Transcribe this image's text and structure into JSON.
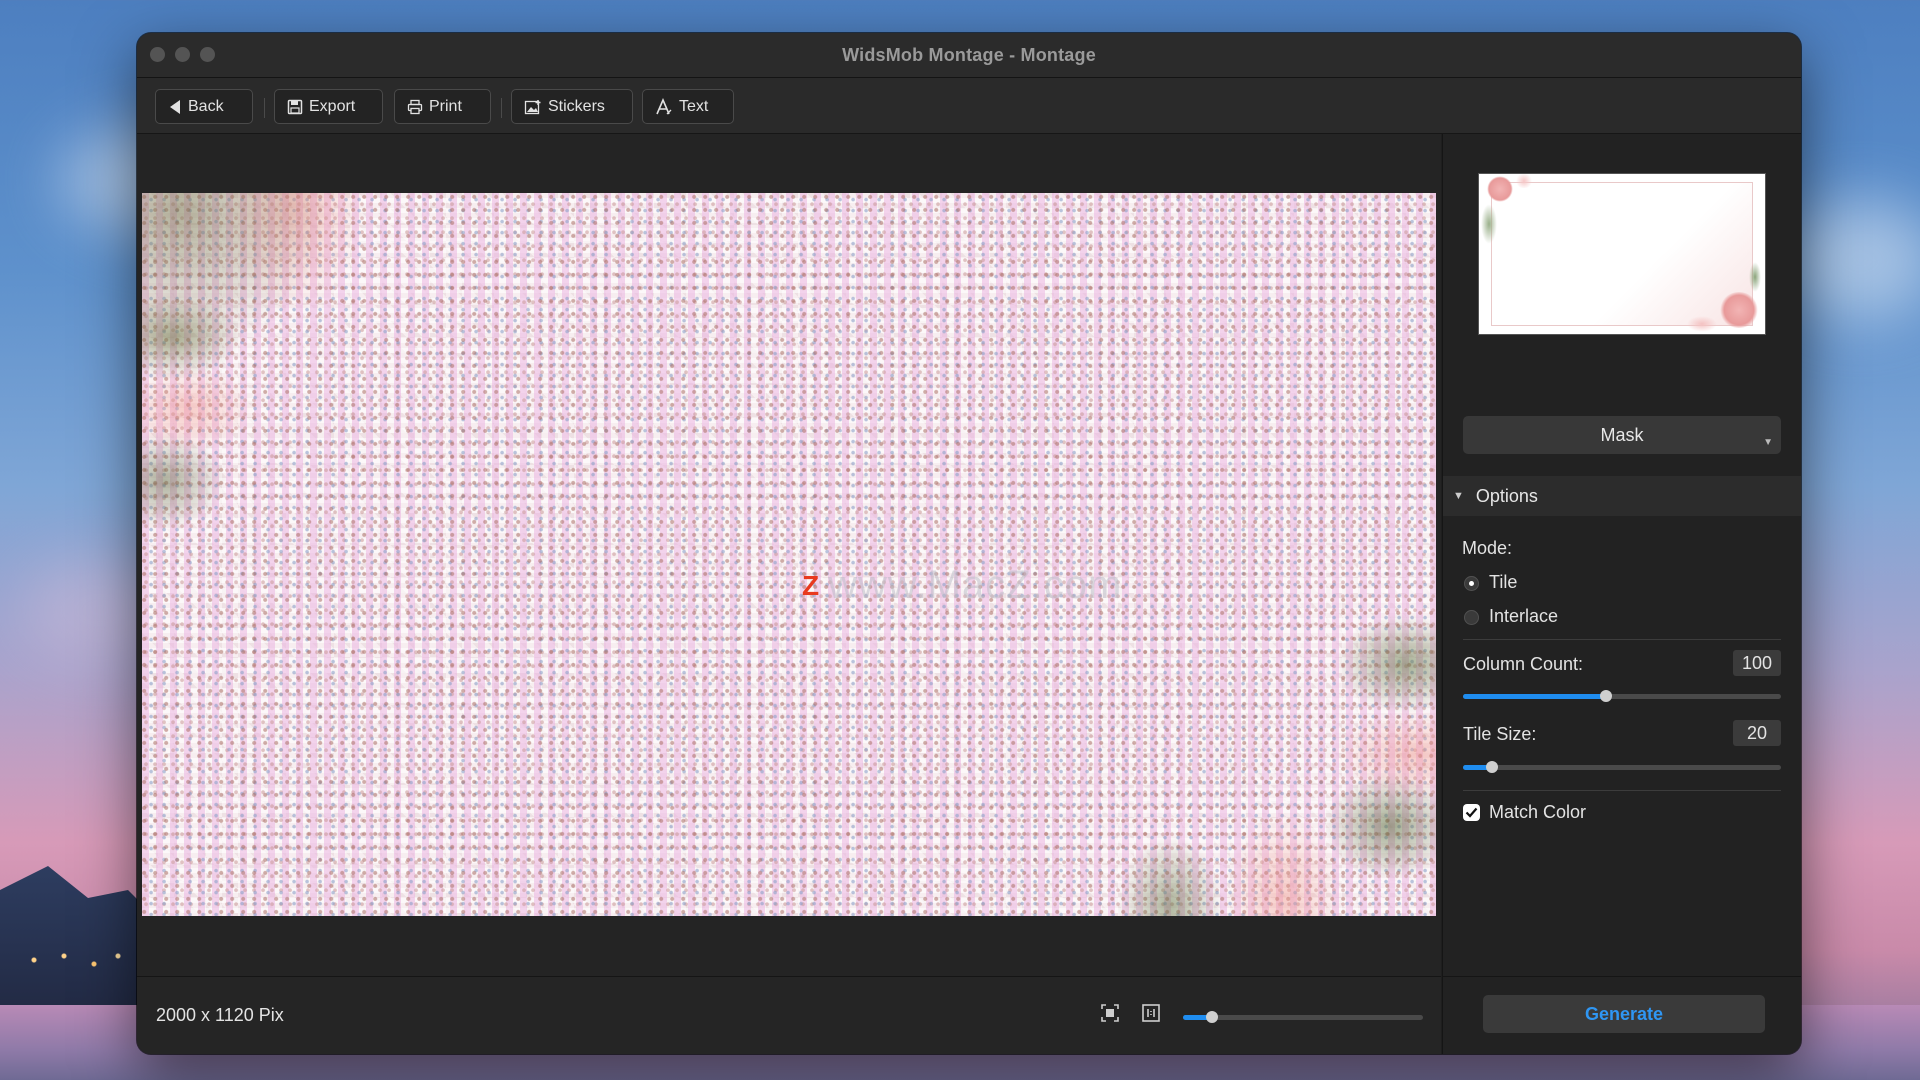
{
  "window": {
    "title": "WidsMob Montage - Montage"
  },
  "toolbar": {
    "back_label": "Back",
    "export_label": "Export",
    "print_label": "Print",
    "stickers_label": "Stickers",
    "text_label": "Text"
  },
  "canvas": {
    "watermark_text": "www.MacZ.com",
    "watermark_logo": "Z"
  },
  "side": {
    "mask_label": "Mask",
    "options_label": "Options",
    "mode_label": "Mode:",
    "mode_options": [
      "Tile",
      "Interlace"
    ],
    "mode_selected": "Tile",
    "column_count_label": "Column Count:",
    "column_count_value": "100",
    "column_count_fraction": 0.45,
    "tile_size_label": "Tile Size:",
    "tile_size_value": "20",
    "tile_size_fraction": 0.09,
    "match_color_label": "Match Color",
    "match_color_checked": true
  },
  "status": {
    "dimensions": "2000 x 1120 Pix",
    "zoom_fraction": 0.12
  },
  "generate_label": "Generate",
  "colors": {
    "accent": "#1f8df0",
    "generate_text": "#2f96f3"
  }
}
